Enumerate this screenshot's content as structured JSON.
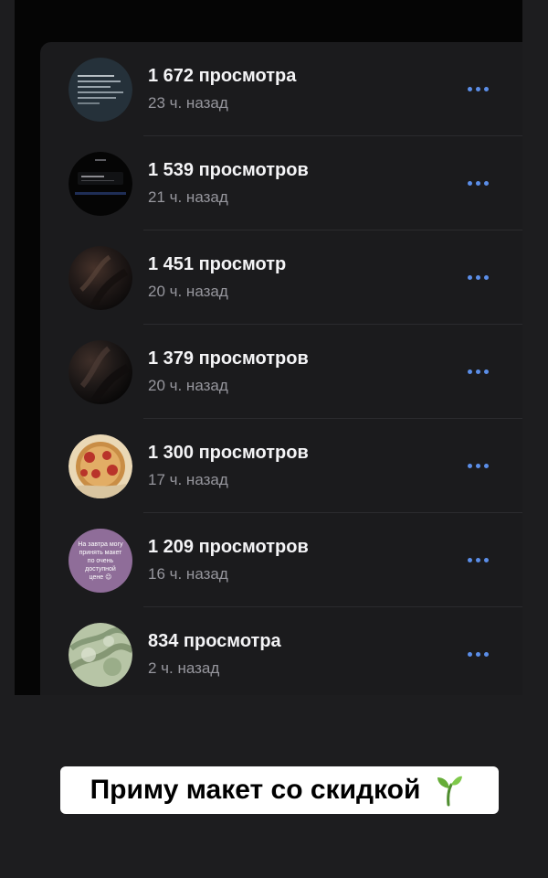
{
  "stats": {
    "rows": [
      {
        "views": "1 672 просмотра",
        "time": "23 ч. назад",
        "thumbnail": "dark-note-image"
      },
      {
        "views": "1 539 просмотров",
        "time": "21 ч. назад",
        "thumbnail": "dark-screenshot-image"
      },
      {
        "views": "1 451 просмотр",
        "time": "20 ч. назад",
        "thumbnail": "dark-fabric-photo"
      },
      {
        "views": "1 379 просмотров",
        "time": "20 ч. назад",
        "thumbnail": "dark-fabric-photo"
      },
      {
        "views": "1 300 просмотров",
        "time": "17 ч. назад",
        "thumbnail": "pizza-photo"
      },
      {
        "views": "1 209 просмотров",
        "time": "16 ч. назад",
        "thumbnail": "lilac-message-thumbnail",
        "thumbnail_text": "На завтра могу\nпринять макет\nпо очень\nдоступной\nцене 😉"
      },
      {
        "views": "834 просмотра",
        "time": "2 ч. назад",
        "thumbnail": "green-pattern-photo"
      }
    ],
    "more_icon": "more-dots-icon",
    "accent": "#5b8ee8"
  },
  "caption": {
    "text": "Приму макет со скидкой",
    "icon": "sprout-icon"
  }
}
